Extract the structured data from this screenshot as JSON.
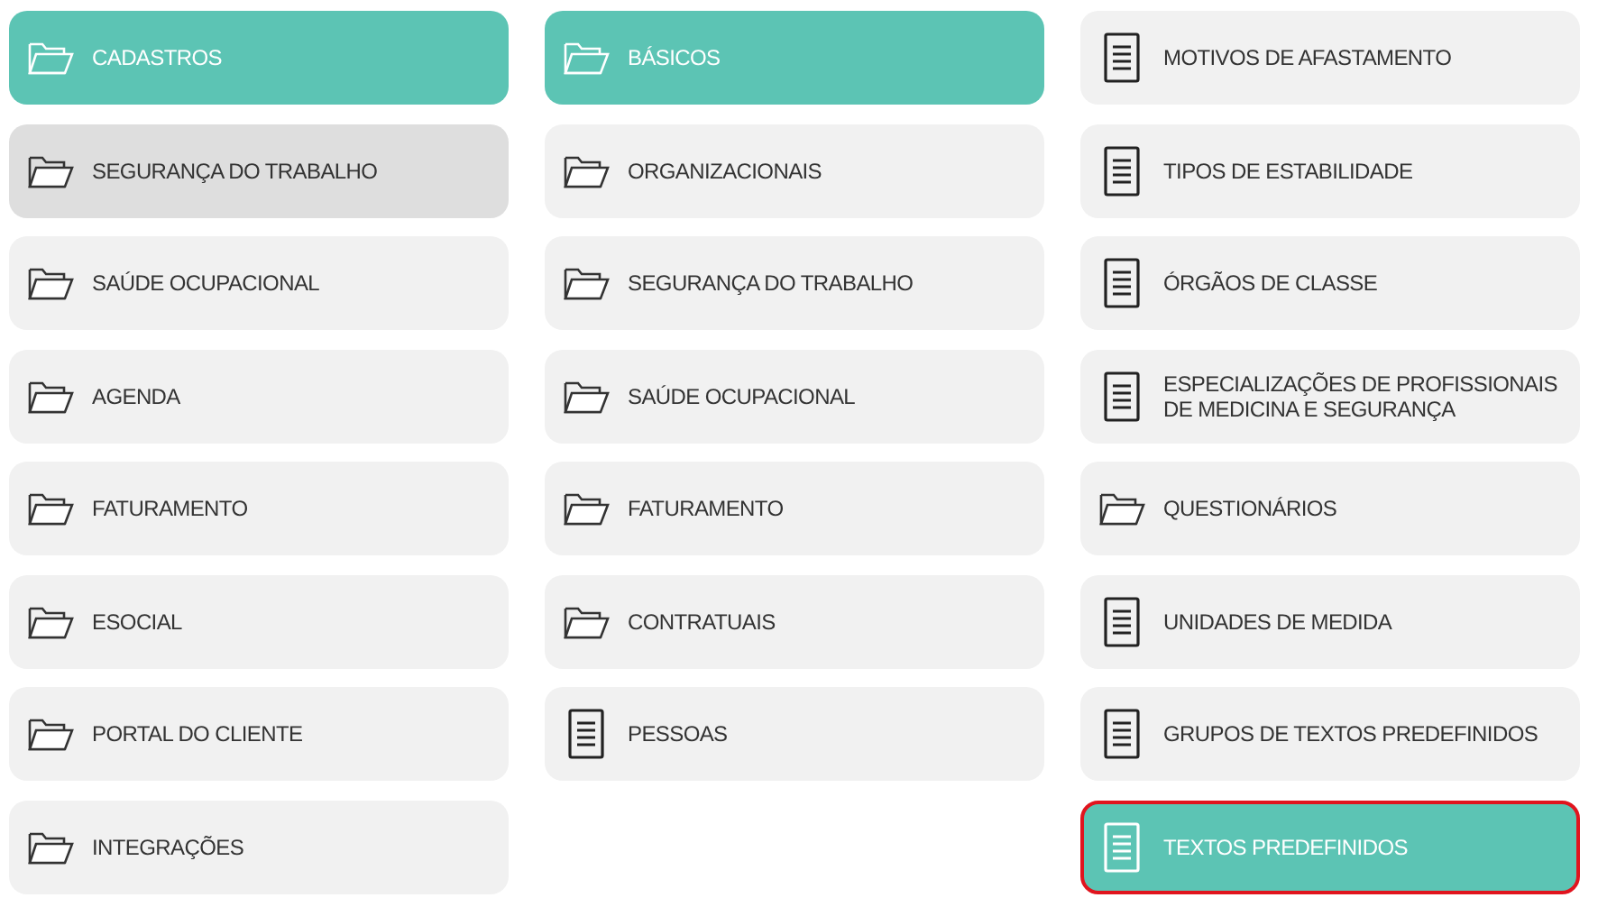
{
  "columns": [
    {
      "items": [
        {
          "kind": "folder",
          "label": "CADASTROS",
          "selected": true,
          "highlighted": false,
          "outlined": false
        },
        {
          "kind": "folder",
          "label": "SEGURANÇA DO TRABALHO",
          "selected": false,
          "highlighted": true,
          "outlined": false
        },
        {
          "kind": "folder",
          "label": "SAÚDE OCUPACIONAL",
          "selected": false,
          "highlighted": false,
          "outlined": false
        },
        {
          "kind": "folder",
          "label": "AGENDA",
          "selected": false,
          "highlighted": false,
          "outlined": false
        },
        {
          "kind": "folder",
          "label": "FATURAMENTO",
          "selected": false,
          "highlighted": false,
          "outlined": false
        },
        {
          "kind": "folder",
          "label": "ESOCIAL",
          "selected": false,
          "highlighted": false,
          "outlined": false
        },
        {
          "kind": "folder",
          "label": "PORTAL DO CLIENTE",
          "selected": false,
          "highlighted": false,
          "outlined": false
        },
        {
          "kind": "folder",
          "label": "INTEGRAÇÕES",
          "selected": false,
          "highlighted": false,
          "outlined": false
        }
      ]
    },
    {
      "items": [
        {
          "kind": "folder",
          "label": "BÁSICOS",
          "selected": true,
          "highlighted": false,
          "outlined": false
        },
        {
          "kind": "folder",
          "label": "ORGANIZACIONAIS",
          "selected": false,
          "highlighted": false,
          "outlined": false
        },
        {
          "kind": "folder",
          "label": "SEGURANÇA DO TRABALHO",
          "selected": false,
          "highlighted": false,
          "outlined": false
        },
        {
          "kind": "folder",
          "label": "SAÚDE OCUPACIONAL",
          "selected": false,
          "highlighted": false,
          "outlined": false
        },
        {
          "kind": "folder",
          "label": "FATURAMENTO",
          "selected": false,
          "highlighted": false,
          "outlined": false
        },
        {
          "kind": "folder",
          "label": "CONTRATUAIS",
          "selected": false,
          "highlighted": false,
          "outlined": false
        },
        {
          "kind": "document",
          "label": "PESSOAS",
          "selected": false,
          "highlighted": false,
          "outlined": false
        }
      ]
    },
    {
      "items": [
        {
          "kind": "document",
          "label": "MOTIVOS DE AFASTAMENTO",
          "selected": false,
          "highlighted": false,
          "outlined": false
        },
        {
          "kind": "document",
          "label": "TIPOS DE ESTABILIDADE",
          "selected": false,
          "highlighted": false,
          "outlined": false
        },
        {
          "kind": "document",
          "label": "ÓRGÃOS DE CLASSE",
          "selected": false,
          "highlighted": false,
          "outlined": false
        },
        {
          "kind": "document",
          "label": "ESPECIALIZAÇÕES DE PROFISSIONAIS DE MEDICINA E SEGURANÇA",
          "selected": false,
          "highlighted": false,
          "outlined": false
        },
        {
          "kind": "folder",
          "label": "QUESTIONÁRIOS",
          "selected": false,
          "highlighted": false,
          "outlined": false
        },
        {
          "kind": "document",
          "label": "UNIDADES DE MEDIDA",
          "selected": false,
          "highlighted": false,
          "outlined": false
        },
        {
          "kind": "document",
          "label": "GRUPOS DE TEXTOS PREDEFINIDOS",
          "selected": false,
          "highlighted": false,
          "outlined": false
        },
        {
          "kind": "document",
          "label": "TEXTOS PREDEFINIDOS",
          "selected": true,
          "highlighted": false,
          "outlined": true
        }
      ]
    }
  ]
}
